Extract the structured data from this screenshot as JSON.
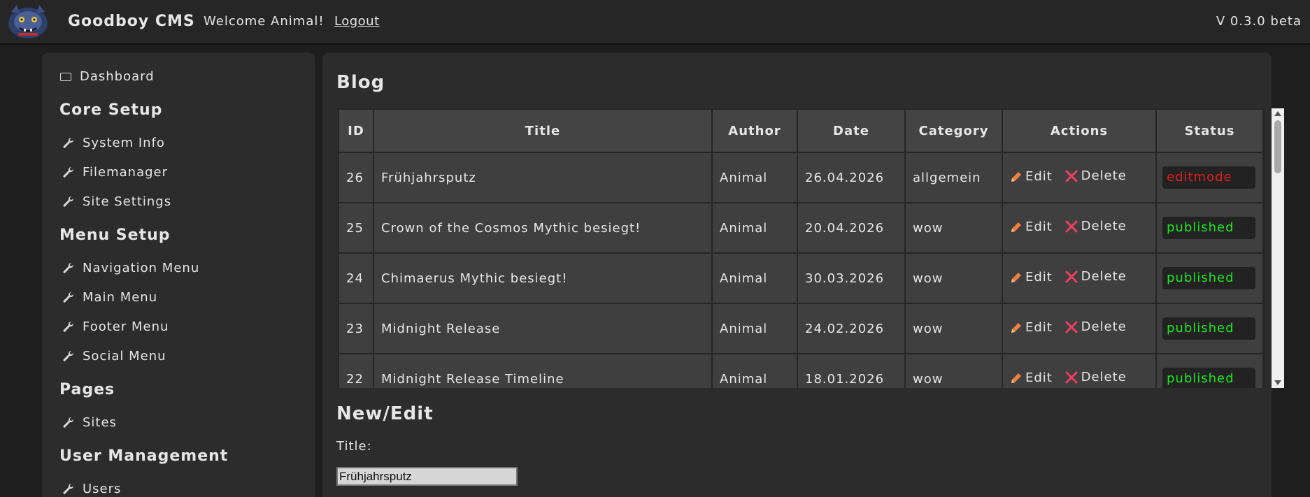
{
  "header": {
    "brand": "Goodboy CMS",
    "welcome": "Welcome Animal!",
    "logout": "Logout",
    "version": "V 0.3.0 beta",
    "logo_icon": "monster-mascot-icon"
  },
  "sidebar": {
    "dashboard": "Dashboard",
    "sections": [
      {
        "title": "Core Setup",
        "items": [
          "System Info",
          "Filemanager",
          "Site Settings"
        ]
      },
      {
        "title": "Menu Setup",
        "items": [
          "Navigation Menu",
          "Main Menu",
          "Footer Menu",
          "Social Menu"
        ]
      },
      {
        "title": "Pages",
        "items": [
          "Sites"
        ]
      },
      {
        "title": "User Management",
        "items": [
          "Users"
        ]
      }
    ]
  },
  "blog": {
    "title": "Blog",
    "columns": [
      "ID",
      "Title",
      "Author",
      "Date",
      "Category",
      "Actions",
      "Status"
    ],
    "edit_label": "Edit",
    "delete_label": "Delete",
    "rows": [
      {
        "id": "26",
        "title": "Frühjahrsputz",
        "author": "Animal",
        "date": "26.04.2026",
        "category": "allgemein",
        "status": "editmode"
      },
      {
        "id": "25",
        "title": "Crown of the Cosmos Mythic besiegt!",
        "author": "Animal",
        "date": "20.04.2026",
        "category": "wow",
        "status": "published"
      },
      {
        "id": "24",
        "title": "Chimaerus Mythic besiegt!",
        "author": "Animal",
        "date": "30.03.2026",
        "category": "wow",
        "status": "published"
      },
      {
        "id": "23",
        "title": "Midnight Release",
        "author": "Animal",
        "date": "24.02.2026",
        "category": "wow",
        "status": "published"
      },
      {
        "id": "22",
        "title": "Midnight Release Timeline",
        "author": "Animal",
        "date": "18.01.2026",
        "category": "wow",
        "status": "published"
      }
    ]
  },
  "editor": {
    "title": "New/Edit",
    "title_label": "Title:",
    "title_value": "Frühjahrsputz"
  },
  "colors": {
    "editmode": "#e01e1e",
    "published": "#19e619",
    "pencil": "#f08040",
    "delete": "#f04060"
  }
}
